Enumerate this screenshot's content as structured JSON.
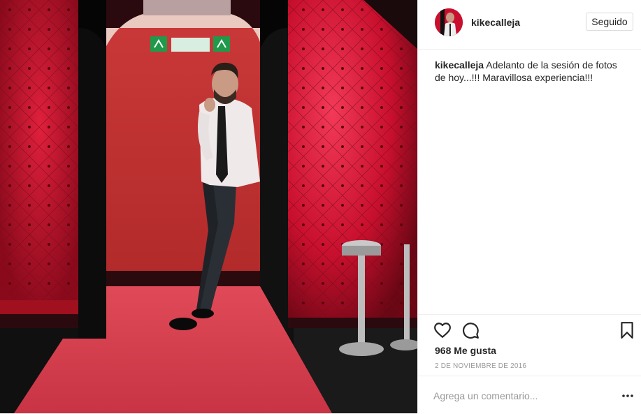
{
  "post": {
    "username": "kikecalleja",
    "follow_label": "Seguido",
    "caption": {
      "username": "kikecalleja",
      "text": "Adelanto de la sesión de fotos de hoy...!!! Maravillosa experiencia!!!"
    },
    "likes": "968 Me gusta",
    "date": "2 DE NOVIEMBRE DE 2016",
    "comment_placeholder": "Agrega un comentario...",
    "photo": {
      "exit_sign": "EXIT"
    }
  },
  "icons": {
    "like": "heart-icon",
    "comment": "comment-icon",
    "save": "bookmark-icon",
    "options": "more-options-icon",
    "avatar": "avatar"
  },
  "colors": {
    "wall_red": "#c8102e",
    "carpet_red": "#d43c4c",
    "text_primary": "#262626",
    "text_muted": "#999999",
    "border": "#dbdbdb"
  }
}
